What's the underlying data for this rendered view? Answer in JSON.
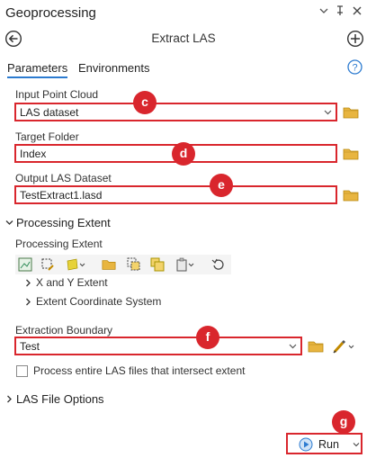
{
  "window": {
    "title": "Geoprocessing"
  },
  "tool": {
    "name": "Extract LAS"
  },
  "tabs": [
    {
      "label": "Parameters",
      "active": true
    },
    {
      "label": "Environments",
      "active": false
    }
  ],
  "params": {
    "input_point_cloud": {
      "label": "Input Point Cloud",
      "value": "LAS dataset",
      "callout": "c"
    },
    "target_folder": {
      "label": "Target Folder",
      "value": "Index",
      "callout": "d"
    },
    "output_las_dataset": {
      "label": "Output LAS Dataset",
      "value": "TestExtract1.lasd",
      "callout": "e"
    }
  },
  "processing_extent": {
    "section_label": "Processing Extent",
    "label": "Processing Extent",
    "xy_extent": "X and Y Extent",
    "coord_system": "Extent Coordinate System"
  },
  "extraction_boundary": {
    "label": "Extraction Boundary",
    "value": "Test",
    "callout": "f"
  },
  "checkbox": {
    "label": "Process entire LAS files that intersect extent",
    "checked": false
  },
  "las_file_options": {
    "label": "LAS File Options"
  },
  "run": {
    "label": "Run",
    "callout": "g"
  },
  "colors": {
    "highlight": "#d9262d",
    "accent": "#2c7bd0",
    "folder": "#e8b540"
  }
}
